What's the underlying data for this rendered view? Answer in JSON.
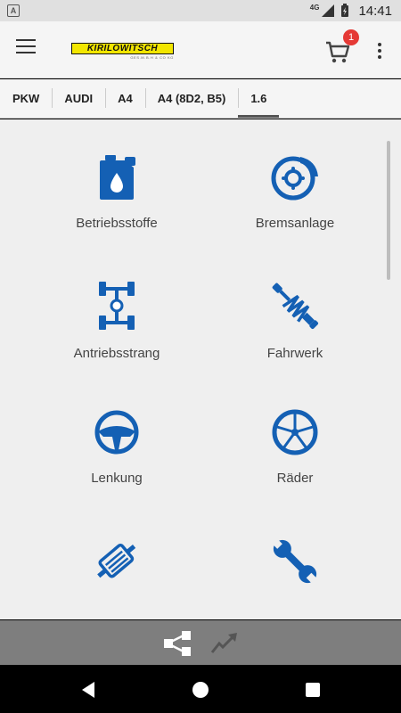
{
  "status_bar": {
    "app_badge": "A",
    "network": "4G",
    "time": "14:41"
  },
  "toolbar": {
    "logo_text": "KIRILOWITSCH",
    "logo_subtext": "GES.M.B.H & CO KG",
    "cart_count": "1"
  },
  "breadcrumb": [
    "PKW",
    "AUDI",
    "A4",
    "A4 (8D2, B5)",
    "1.6"
  ],
  "categories": [
    {
      "label": "Betriebsstoffe",
      "icon": "oil-canister-icon"
    },
    {
      "label": "Bremsanlage",
      "icon": "brake-disc-icon"
    },
    {
      "label": "Antriebsstrang",
      "icon": "drivetrain-icon"
    },
    {
      "label": "Fahrwerk",
      "icon": "shock-absorber-icon"
    },
    {
      "label": "Lenkung",
      "icon": "steering-wheel-icon"
    },
    {
      "label": "Räder",
      "icon": "wheel-icon"
    },
    {
      "label": "",
      "icon": "exhaust-icon"
    },
    {
      "label": "",
      "icon": "wrench-icon"
    }
  ],
  "colors": {
    "accent_blue": "#1460b4",
    "cart_badge": "#e53935",
    "logo_yellow": "#f2e600"
  }
}
